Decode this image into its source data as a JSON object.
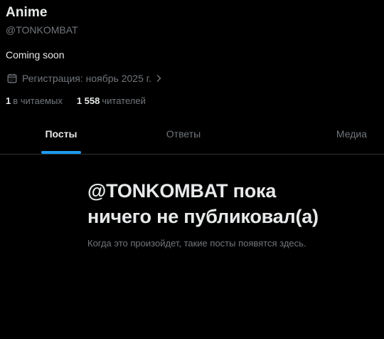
{
  "profile": {
    "display_name": "Anime",
    "handle": "@TONKOMBAT",
    "bio": "Coming soon",
    "join_date_icon": "calendar-icon",
    "join_date": "Регистрация: ноябрь 2025 г.",
    "join_chevron_icon": "chevron-right-icon",
    "following_count": "1",
    "following_label": "в читаемых",
    "followers_count": "1 558",
    "followers_label": "читателей"
  },
  "tabs": [
    {
      "label": "Посты",
      "active": true
    },
    {
      "label": "Ответы",
      "active": false
    },
    {
      "label": "Медиа",
      "active": false
    }
  ],
  "empty_state": {
    "title": "@TONKOMBAT пока ничего не публиковал(а)",
    "subtitle": "Когда это произойдет, такие посты появятся здесь."
  },
  "colors": {
    "background": "#000000",
    "text_primary": "#e7e9ea",
    "text_secondary": "#71767b",
    "accent": "#1d9bf0",
    "divider": "#2f3336"
  }
}
